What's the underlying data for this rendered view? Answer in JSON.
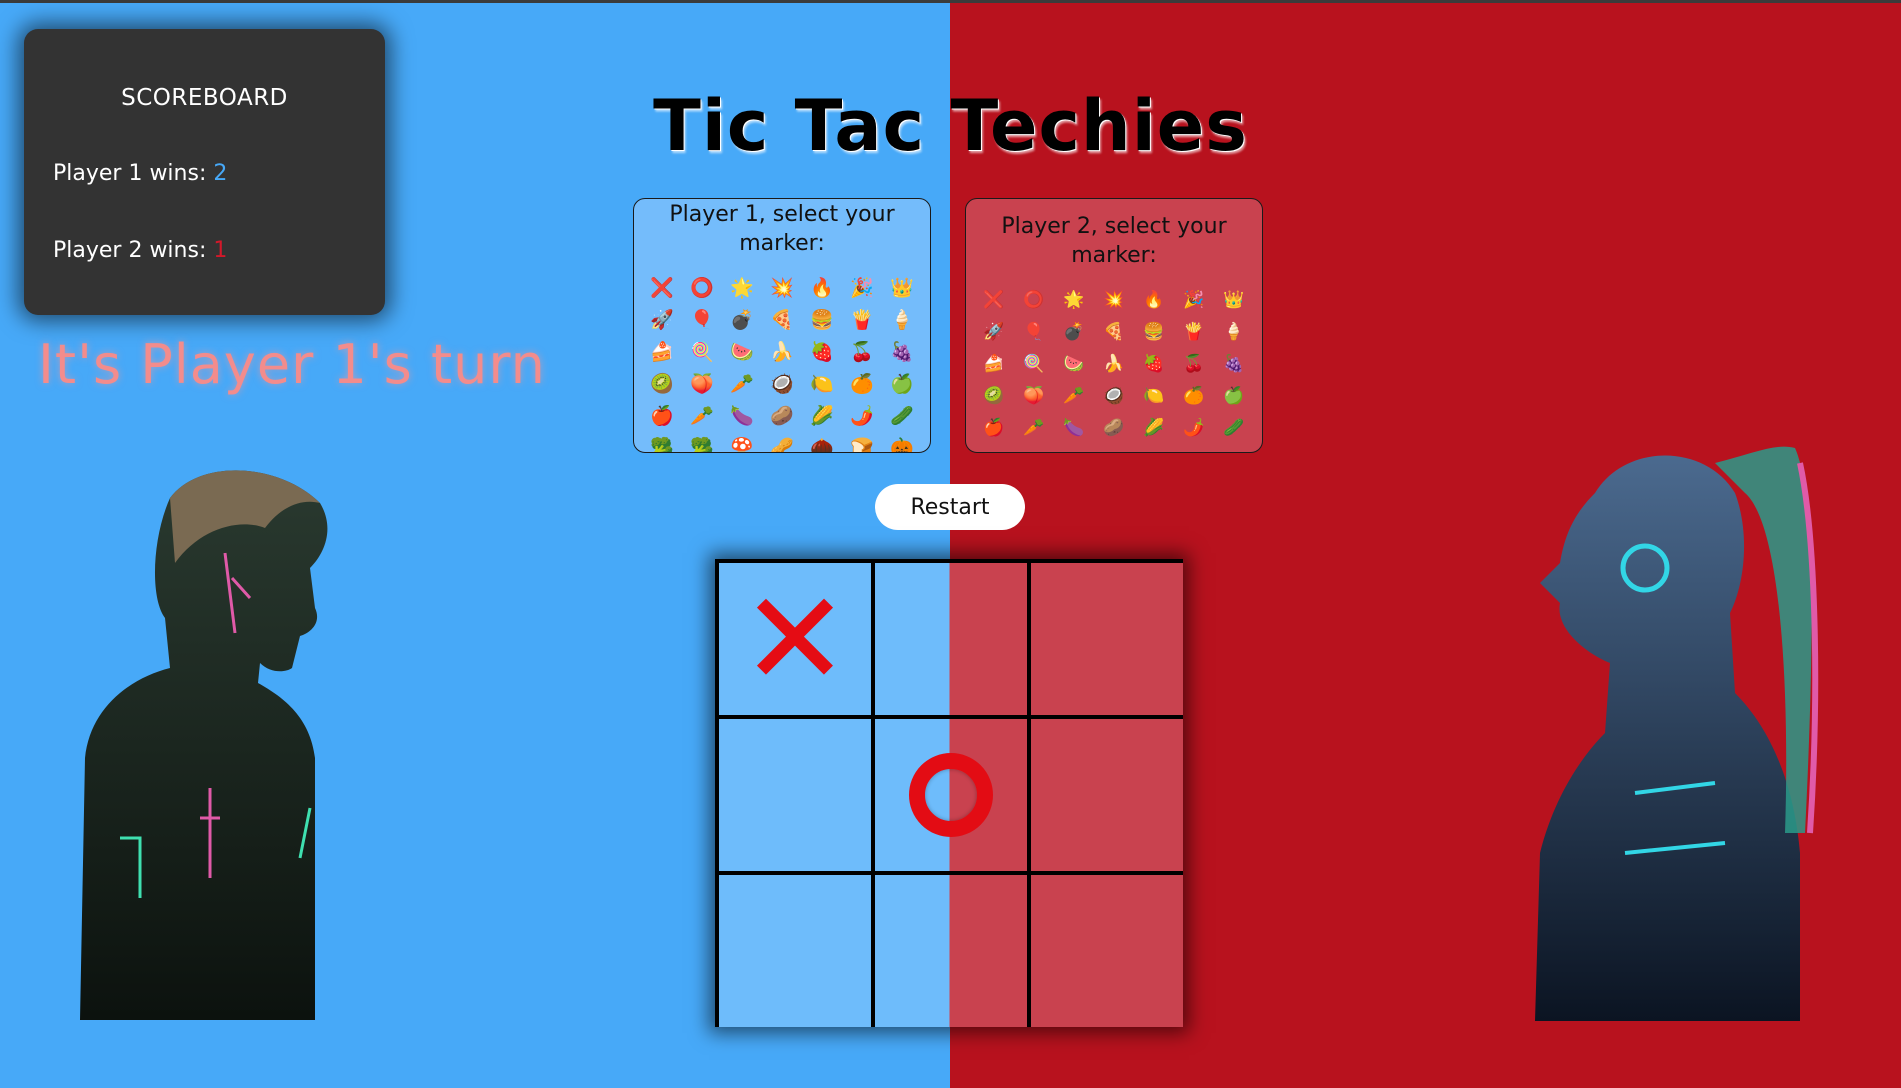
{
  "scoreboard": {
    "title": "SCOREBOARD",
    "p1_label": "Player 1 wins: ",
    "p1_value": "2",
    "p2_label": "Player 2 wins: ",
    "p2_value": "1"
  },
  "title": "Tic Tac Techies",
  "turn_text": "It's Player 1's turn",
  "picker1": {
    "label": "Player 1, select your marker:",
    "markers": [
      "❌",
      "⭕",
      "🌟",
      "💥",
      "🔥",
      "🎉",
      "👑",
      "🚀",
      "🎈",
      "💣",
      "🍕",
      "🍔",
      "🍟",
      "🍦",
      "🍰",
      "🍭",
      "🍉",
      "🍌",
      "🍓",
      "🍒",
      "🍇",
      "🥝",
      "🍑",
      "🥕",
      "🥥",
      "🍋",
      "🍊",
      "🍏",
      "🍎",
      "🥕",
      "🍆",
      "🥔",
      "🌽",
      "🌶️",
      "🥒",
      "🥦",
      "🥦",
      "🍄",
      "🥜",
      "🌰",
      "🍞",
      "🎃"
    ]
  },
  "picker2": {
    "label": "Player 2, select your marker:",
    "markers": [
      "❌",
      "⭕",
      "🌟",
      "💥",
      "🔥",
      "🎉",
      "👑",
      "🚀",
      "🎈",
      "💣",
      "🍕",
      "🍔",
      "🍟",
      "🍦",
      "🍰",
      "🍭",
      "🍉",
      "🍌",
      "🍓",
      "🍒",
      "🍇",
      "🥝",
      "🍑",
      "🥕",
      "🥥",
      "🍋",
      "🍊",
      "🍏",
      "🍎",
      "🥕",
      "🍆",
      "🥔",
      "🌽",
      "🌶️",
      "🥒"
    ]
  },
  "restart_label": "Restart",
  "board": [
    "X",
    "",
    "",
    "",
    "O",
    "",
    "",
    "",
    ""
  ],
  "colors": {
    "player1": "#47a9f8",
    "player2": "#b8121e"
  },
  "avatars": {
    "left": "cyber-boy-avatar",
    "right": "cyber-girl-avatar"
  }
}
